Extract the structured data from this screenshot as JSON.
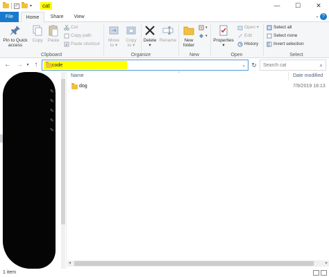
{
  "window": {
    "title": "cat",
    "controls": {
      "minimize": "—",
      "maximize": "☐",
      "close": "✕"
    }
  },
  "ribbon_tabs": [
    "File",
    "Home",
    "Share",
    "View"
  ],
  "ribbon": {
    "clipboard": {
      "label": "Clipboard",
      "pin_label_1": "Pin to Quick",
      "pin_label_2": "access",
      "copy": "Copy",
      "paste": "Paste",
      "cut": "Cut",
      "copy_path": "Copy path",
      "paste_shortcut": "Paste shortcut"
    },
    "organize": {
      "label": "Organize",
      "move_to_1": "Move",
      "move_to_2": "to ▾",
      "copy_to_1": "Copy",
      "copy_to_2": "to ▾",
      "delete_1": "Delete",
      "delete_2": "▾",
      "rename": "Rename"
    },
    "new": {
      "label": "New",
      "new_folder_1": "New",
      "new_folder_2": "folder"
    },
    "open": {
      "label": "Open",
      "properties_1": "Properties",
      "properties_2": "▾",
      "open": "Open ▾",
      "edit": "Edit",
      "history": "History"
    },
    "select": {
      "label": "Select",
      "select_all": "Select all",
      "select_none": "Select none",
      "invert_selection": "Invert selection"
    }
  },
  "nav": {
    "back": "←",
    "forward": "→",
    "recent": "▾",
    "up": "↑",
    "refresh": "↻"
  },
  "address": {
    "path": "code",
    "caret": "⌄"
  },
  "search": {
    "placeholder": "Search cat"
  },
  "columns": {
    "name": "Name",
    "date_modified": "Date modified",
    "sort_glyph": "^"
  },
  "files": [
    {
      "name": "dog",
      "date_modified": "7/9/2019 18:13",
      "icon": "folder-icon"
    }
  ],
  "status": {
    "item_count": "1 item"
  },
  "colors": {
    "accent": "#1979ca",
    "highlight": "#ffff00",
    "folder": "#f0c040",
    "redaction": "#050505"
  }
}
